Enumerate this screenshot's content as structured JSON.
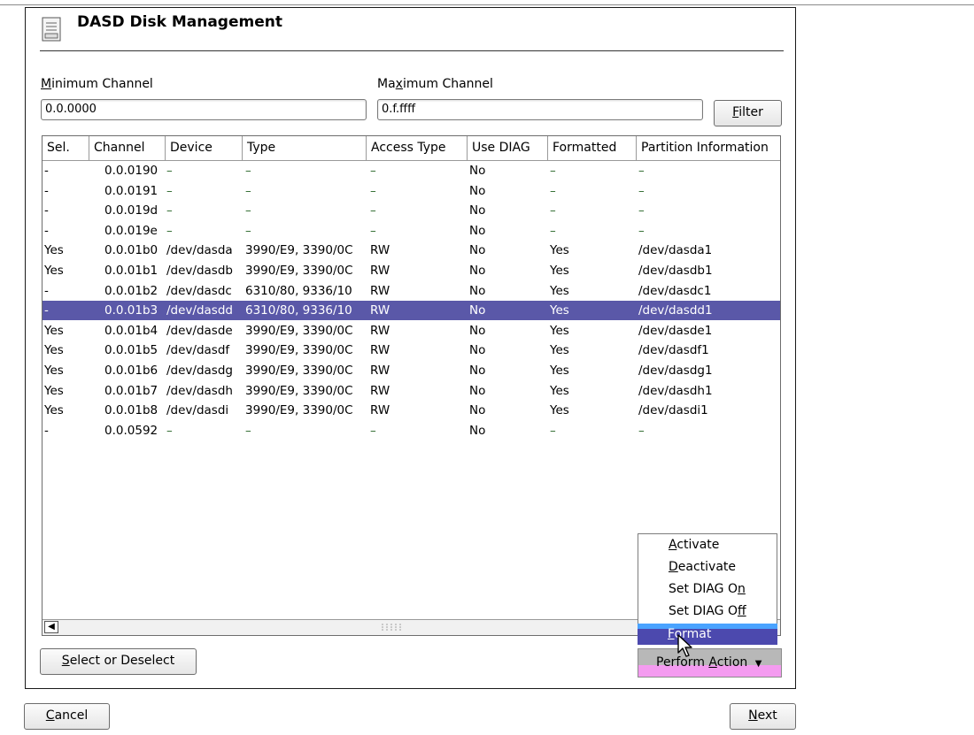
{
  "title": "DASD Disk Management",
  "min_channel": {
    "label_pre": "",
    "label_key": "M",
    "label_post": "inimum Channel",
    "value": "0.0.0000"
  },
  "max_channel": {
    "label_pre": "Ma",
    "label_key": "x",
    "label_post": "imum Channel",
    "value": "0.f.ffff"
  },
  "filter_button": {
    "key": "F",
    "rest": "ilter"
  },
  "columns": [
    "Sel.",
    "Channel",
    "Device",
    "Type",
    "Access Type",
    "Use DIAG",
    "Formatted",
    "Partition Information"
  ],
  "rows": [
    {
      "sel": "-",
      "channel": "0.0.0190",
      "device": "–",
      "type": "–",
      "access": "–",
      "diag": "No",
      "formatted": "–",
      "partition": "–"
    },
    {
      "sel": "-",
      "channel": "0.0.0191",
      "device": "–",
      "type": "–",
      "access": "–",
      "diag": "No",
      "formatted": "–",
      "partition": "–"
    },
    {
      "sel": "-",
      "channel": "0.0.019d",
      "device": "–",
      "type": "–",
      "access": "–",
      "diag": "No",
      "formatted": "–",
      "partition": "–"
    },
    {
      "sel": "-",
      "channel": "0.0.019e",
      "device": "–",
      "type": "–",
      "access": "–",
      "diag": "No",
      "formatted": "–",
      "partition": "–"
    },
    {
      "sel": "Yes",
      "channel": "0.0.01b0",
      "device": "/dev/dasda",
      "type": "3990/E9, 3390/0C",
      "access": "RW",
      "diag": "No",
      "formatted": "Yes",
      "partition": "/dev/dasda1"
    },
    {
      "sel": "Yes",
      "channel": "0.0.01b1",
      "device": "/dev/dasdb",
      "type": "3990/E9, 3390/0C",
      "access": "RW",
      "diag": "No",
      "formatted": "Yes",
      "partition": "/dev/dasdb1"
    },
    {
      "sel": "-",
      "channel": "0.0.01b2",
      "device": "/dev/dasdc",
      "type": "6310/80, 9336/10",
      "access": "RW",
      "diag": "No",
      "formatted": "Yes",
      "partition": "/dev/dasdc1"
    },
    {
      "sel": "-",
      "channel": "0.0.01b3",
      "device": "/dev/dasdd",
      "type": "6310/80, 9336/10",
      "access": "RW",
      "diag": "No",
      "formatted": "Yes",
      "partition": "/dev/dasdd1",
      "selected": true
    },
    {
      "sel": "Yes",
      "channel": "0.0.01b4",
      "device": "/dev/dasde",
      "type": "3990/E9, 3390/0C",
      "access": "RW",
      "diag": "No",
      "formatted": "Yes",
      "partition": "/dev/dasde1"
    },
    {
      "sel": "Yes",
      "channel": "0.0.01b5",
      "device": "/dev/dasdf",
      "type": "3990/E9, 3390/0C",
      "access": "RW",
      "diag": "No",
      "formatted": "Yes",
      "partition": "/dev/dasdf1"
    },
    {
      "sel": "Yes",
      "channel": "0.0.01b6",
      "device": "/dev/dasdg",
      "type": "3990/E9, 3390/0C",
      "access": "RW",
      "diag": "No",
      "formatted": "Yes",
      "partition": "/dev/dasdg1"
    },
    {
      "sel": "Yes",
      "channel": "0.0.01b7",
      "device": "/dev/dasdh",
      "type": "3990/E9, 3390/0C",
      "access": "RW",
      "diag": "No",
      "formatted": "Yes",
      "partition": "/dev/dasdh1"
    },
    {
      "sel": "Yes",
      "channel": "0.0.01b8",
      "device": "/dev/dasdi",
      "type": "3990/E9, 3390/0C",
      "access": "RW",
      "diag": "No",
      "formatted": "Yes",
      "partition": "/dev/dasdi1"
    },
    {
      "sel": "-",
      "channel": "0.0.0592",
      "device": "–",
      "type": "–",
      "access": "–",
      "diag": "No",
      "formatted": "–",
      "partition": "–"
    }
  ],
  "menu": [
    {
      "pre": "",
      "key": "A",
      "post": "ctivate"
    },
    {
      "pre": "",
      "key": "D",
      "post": "eactivate"
    },
    {
      "pre": "Set DIAG O",
      "key": "n",
      "post": ""
    },
    {
      "pre": "Set DIAG O",
      "key": "f",
      "post": "f"
    },
    {
      "pre": "",
      "key": "F",
      "post": "ormat"
    }
  ],
  "perform_action": {
    "pre": "Perform ",
    "key": "A",
    "post": "ction"
  },
  "select_button": {
    "key": "S",
    "rest": "elect or Deselect"
  },
  "cancel_button": {
    "key": "C",
    "rest": "ancel"
  },
  "next_button": {
    "key": "N",
    "rest": "ext"
  },
  "colors": {
    "selection": "#5a58a8",
    "menu_highlight": "#4c49ae",
    "dash": "#2e6b2e"
  }
}
